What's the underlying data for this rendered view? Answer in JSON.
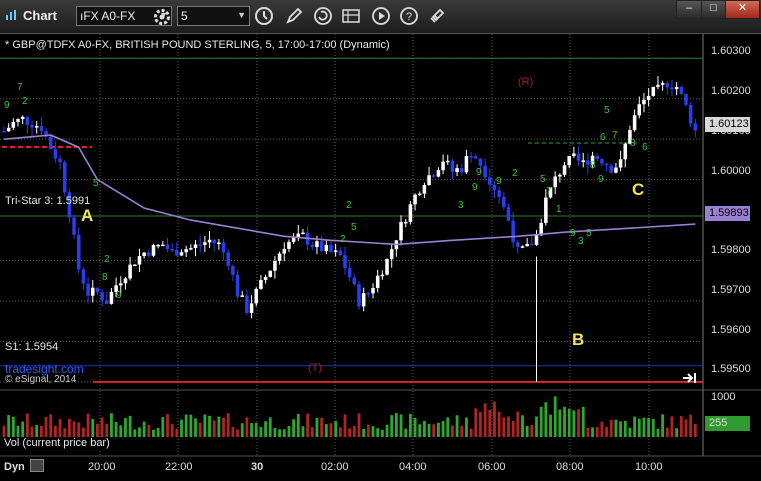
{
  "window": {
    "title": "Chart"
  },
  "toolbar": {
    "symbol_value": "ıFX A0-FX",
    "interval_value": "5"
  },
  "chart": {
    "header": "* GBP@TDFX A0-FX, BRITISH POUND STERLING, 5, 17:00-17:00 (Dynamic)",
    "tristar_label": "Tri-Star 3: 1.5991",
    "s1_label": "S1: 1.5954",
    "brand": "tradesight.com",
    "copyright": "© eSignal, 2014",
    "r_label": "(R)",
    "t_label": "(T)",
    "markers": [
      "A",
      "B",
      "C"
    ],
    "price_axis": [
      "1.60300",
      "1.60200",
      "1.60100",
      "1.60000",
      "1.59800",
      "1.59700",
      "1.59600",
      "1.59500"
    ],
    "last_price": "1.60123",
    "ma_price": "1.59893",
    "green_digits": [
      "7",
      "9",
      "2",
      "5",
      "2",
      "8",
      "9",
      "2",
      "5",
      "2",
      "3",
      "9",
      "9",
      "9",
      "2",
      "5",
      "6",
      "7",
      "8",
      "9",
      "8",
      "6",
      "5",
      "7",
      "1",
      "9",
      "3",
      "5"
    ]
  },
  "volume": {
    "label": "Vol (current price bar)",
    "axis": [
      "1000"
    ],
    "current": "255"
  },
  "time_axis": {
    "mode": "Dyn",
    "labels": [
      "20:00",
      "22:00",
      "30",
      "02:00",
      "04:00",
      "06:00",
      "08:00",
      "10:00"
    ]
  },
  "colors": {
    "up": "#ffffff",
    "down": "#2a3df0",
    "ma": "#9b7fd2",
    "support": "#e0262b",
    "s1": "#2030c0",
    "grid": "#5c5c5c",
    "counter": "#3bc43b"
  },
  "chart_data": {
    "type": "candlestick",
    "title": "GBP@TDFX A0-FX, BRITISH POUND STERLING, 5, 17:00-17:00 (Dynamic)",
    "x_labels": [
      "20:00",
      "22:00",
      "30",
      "02:00",
      "04:00",
      "06:00",
      "08:00",
      "10:00"
    ],
    "ylim": [
      1.5948,
      1.6036
    ],
    "price_ticks": [
      1.603,
      1.602,
      1.601,
      1.6,
      1.598,
      1.597,
      1.596,
      1.595
    ],
    "close_path": [
      [
        0,
        1.6012
      ],
      [
        2,
        1.6014
      ],
      [
        4,
        1.6015
      ],
      [
        6,
        1.6014
      ],
      [
        8,
        1.6013
      ],
      [
        10,
        1.6008
      ],
      [
        12,
        1.6004
      ],
      [
        14,
        1.5992
      ],
      [
        16,
        1.5978
      ],
      [
        18,
        1.5972
      ],
      [
        20,
        1.5972
      ],
      [
        22,
        1.597
      ],
      [
        24,
        1.5974
      ],
      [
        26,
        1.5977
      ],
      [
        28,
        1.598
      ],
      [
        30,
        1.5982
      ],
      [
        32,
        1.5983
      ],
      [
        34,
        1.5984
      ],
      [
        36,
        1.5982
      ],
      [
        38,
        1.5983
      ],
      [
        40,
        1.5983
      ],
      [
        42,
        1.5984
      ],
      [
        44,
        1.5985
      ],
      [
        46,
        1.5984
      ],
      [
        48,
        1.598
      ],
      [
        50,
        1.5972
      ],
      [
        52,
        1.5968
      ],
      [
        54,
        1.5972
      ],
      [
        56,
        1.5976
      ],
      [
        58,
        1.598
      ],
      [
        60,
        1.5984
      ],
      [
        62,
        1.5985
      ],
      [
        64,
        1.5986
      ],
      [
        66,
        1.5984
      ],
      [
        68,
        1.5983
      ],
      [
        70,
        1.5982
      ],
      [
        72,
        1.5981
      ],
      [
        74,
        1.5976
      ],
      [
        76,
        1.597
      ],
      [
        78,
        1.5972
      ],
      [
        80,
        1.5976
      ],
      [
        82,
        1.598
      ],
      [
        84,
        1.5986
      ],
      [
        86,
        1.5991
      ],
      [
        88,
        1.5996
      ],
      [
        90,
        1.6
      ],
      [
        92,
        1.6002
      ],
      [
        94,
        1.6005
      ],
      [
        96,
        1.6002
      ],
      [
        98,
        1.6003
      ],
      [
        100,
        1.6007
      ],
      [
        102,
        1.6004
      ],
      [
        104,
        1.6
      ],
      [
        106,
        1.5996
      ],
      [
        108,
        1.599
      ],
      [
        110,
        1.5982
      ],
      [
        112,
        1.5983
      ],
      [
        114,
        1.5986
      ],
      [
        116,
        1.5995
      ],
      [
        118,
        1.6
      ],
      [
        120,
        1.6004
      ],
      [
        122,
        1.6005
      ],
      [
        124,
        1.6004
      ],
      [
        126,
        1.6006
      ],
      [
        128,
        1.6005
      ],
      [
        130,
        1.6003
      ],
      [
        132,
        1.6004
      ],
      [
        134,
        1.6013
      ],
      [
        136,
        1.6018
      ],
      [
        138,
        1.6021
      ],
      [
        140,
        1.6022
      ],
      [
        142,
        1.6024
      ],
      [
        144,
        1.6023
      ],
      [
        146,
        1.6018
      ],
      [
        148,
        1.6012
      ]
    ],
    "ma_path": [
      [
        0,
        1.601
      ],
      [
        10,
        1.6011
      ],
      [
        16,
        1.6008
      ],
      [
        20,
        1.6
      ],
      [
        30,
        1.5993
      ],
      [
        40,
        1.599
      ],
      [
        50,
        1.5988
      ],
      [
        60,
        1.5986
      ],
      [
        70,
        1.5985
      ],
      [
        84,
        1.5984
      ],
      [
        96,
        1.5985
      ],
      [
        110,
        1.5986
      ],
      [
        120,
        1.5987
      ],
      [
        134,
        1.5988
      ],
      [
        148,
        1.5989
      ]
    ],
    "levels": {
      "tri_star_3": 1.5991,
      "s1": 1.5954,
      "support_T": 1.595,
      "resistance_R": 1.603
    },
    "volume_max": 1000
  }
}
